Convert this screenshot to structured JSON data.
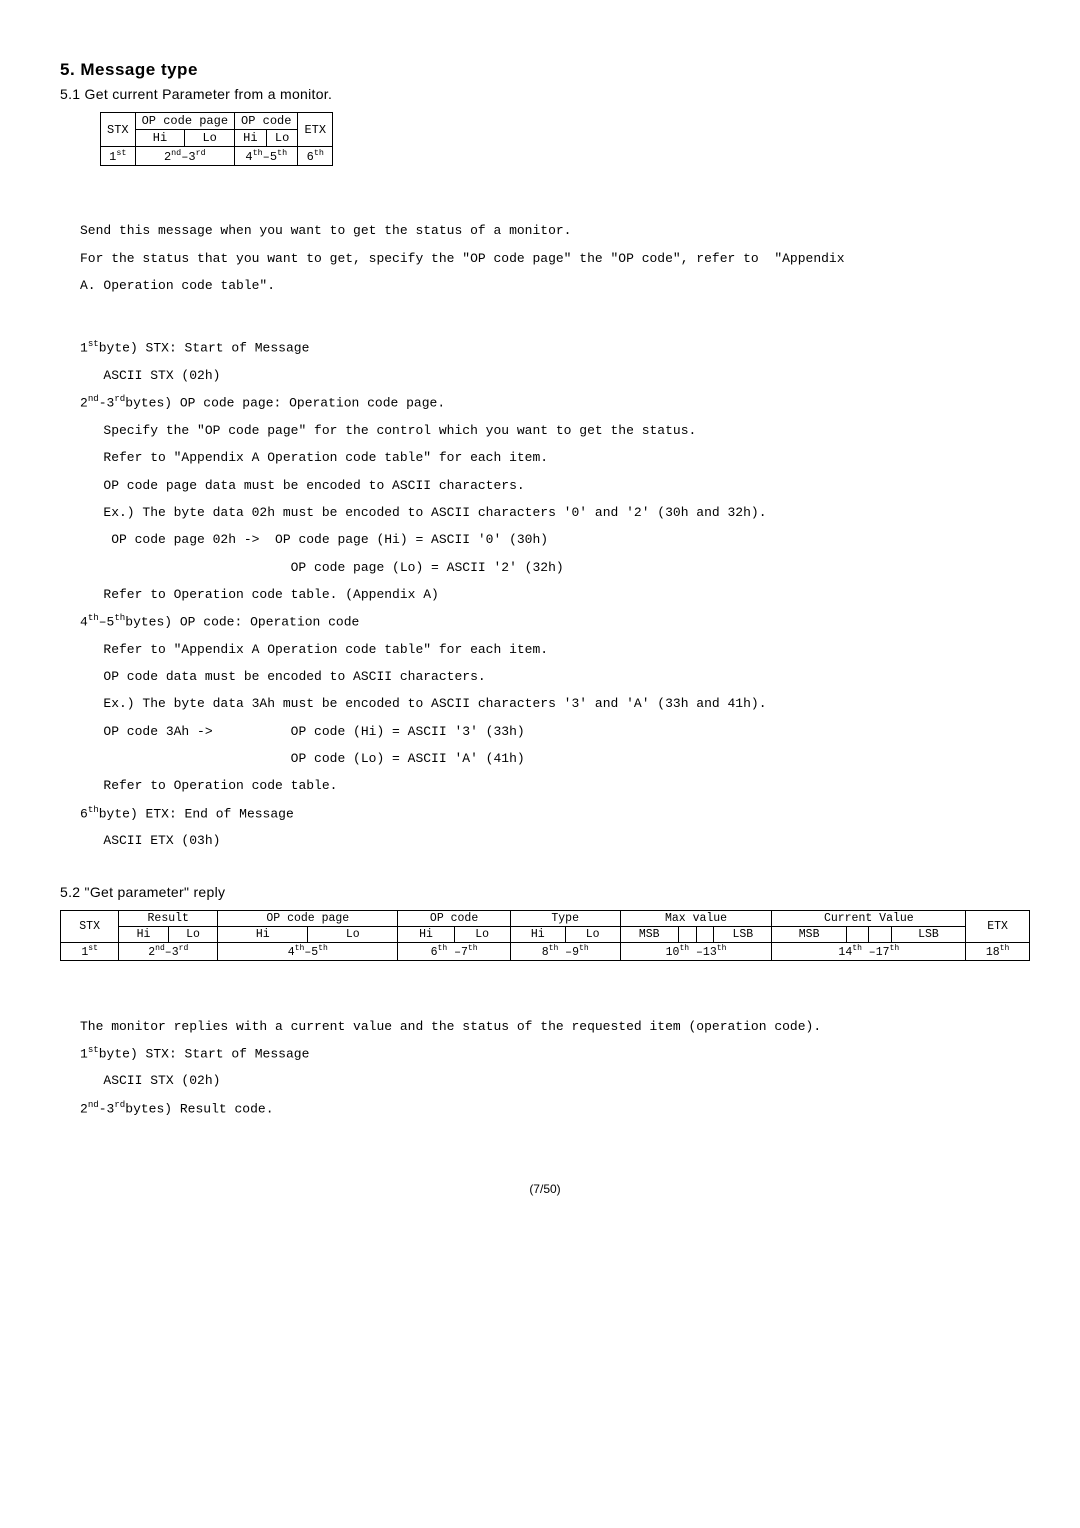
{
  "section_num": "5. Message type",
  "sub51": "5.1 Get current Parameter from a monitor.",
  "t1": {
    "h": [
      "STX",
      "OP code page",
      "OP code",
      "ETX"
    ],
    "sub": [
      "Hi",
      "Lo",
      "Hi",
      "Lo"
    ],
    "r": [
      "1",
      "st",
      "2",
      "nd",
      "–3",
      "rd",
      "4",
      "th",
      "–5",
      "th",
      "6",
      "th"
    ]
  },
  "t1_rows": {
    "r0c0": "STX",
    "r0c1": "OP code page",
    "r0c2": "OP code",
    "r0c3": "ETX",
    "r1c0": "Hi",
    "r1c1": "Lo",
    "r1c2": "Hi",
    "r1c3": "Lo",
    "r2c0_a": "1",
    "r2c0_b": "st",
    "r2c1_a": "2",
    "r2c1_b": "nd",
    "r2c1_c": "–3",
    "r2c1_d": "rd",
    "r2c2_a": "4",
    "r2c2_b": "th",
    "r2c2_c": "–5",
    "r2c2_d": "th",
    "r2c3_a": "6",
    "r2c3_b": "th"
  },
  "body1_l1": "Send this message when you want to get the status of a monitor.",
  "body1_l2": "For the status that you want to get, specify the \"OP code page\" the \"OP code\", refer to  \"Appendix",
  "body1_l3": "A. Operation code table\".",
  "b1_a": "1",
  "b1_b": "st",
  "b1_c": "byte) STX: Start of Message",
  "b1_d": "ASCII STX (02h)",
  "b2_a": "2",
  "b2_b": "nd",
  "b2_c": "-3",
  "b2_d": "rd",
  "b2_e": "bytes) OP code page: Operation code page.",
  "b2_l1": "Specify the \"OP code page\" for the control which you want to get the status.",
  "b2_l2": "Refer to \"Appendix A Operation code table\" for each item.",
  "b2_l3": "OP code page data must be encoded to ASCII characters.",
  "b2_l4": "Ex.) The byte data 02h must be encoded to ASCII characters '0' and '2' (30h and 32h).",
  "b2_l5": " OP code page 02h ->  OP code page (Hi) = ASCII '0' (30h)",
  "b2_l6": "                           OP code page (Lo) = ASCII '2' (32h)",
  "b2_l7": "Refer to Operation code table. (Appendix A)",
  "b3_a": "4",
  "b3_b": "th",
  "b3_c": "–5",
  "b3_d": "th",
  "b3_e": "bytes) OP code: Operation code",
  "b3_l1": "Refer to \"Appendix A Operation code table\" for each item.",
  "b3_l2": "OP code data must be encoded to ASCII characters.",
  "b3_l3": "Ex.) The byte data 3Ah must be encoded to ASCII characters '3' and 'A' (33h and 41h).",
  "b3_l4": "OP code 3Ah ->          OP code (Hi) = ASCII '3' (33h)",
  "b3_l5": "                        OP code (Lo) = ASCII 'A' (41h)",
  "b3_l6": "Refer to Operation code table.",
  "b4_a": "6",
  "b4_b": "th",
  "b4_c": "byte) ETX: End of Message",
  "b4_d": "ASCII ETX (03h)",
  "sub52": "5.2 \"Get parameter\" reply",
  "t2": {
    "h0": "STX",
    "h1": "Result",
    "h2": "OP code page",
    "h3": "OP code",
    "h4": "Type",
    "h5": "Max value",
    "h6": "Current Value",
    "h7": "ETX",
    "s1a": "Hi",
    "s1b": "Lo",
    "s2a": "Hi",
    "s2b": "Lo",
    "s3a": "Hi",
    "s3b": "Lo",
    "s4a": "Hi",
    "s4b": "Lo",
    "s5a": "MSB",
    "s5b": "",
    "s5c": "",
    "s5d": "LSB",
    "s6a": "MSB",
    "s6b": "",
    "s6c": "",
    "s6d": "LSB",
    "r0_a": "1",
    "r0_b": "st",
    "r1_a": "2",
    "r1_b": "nd",
    "r1_c": "–3",
    "r1_d": "rd",
    "r2_a": "4",
    "r2_b": "th",
    "r2_c": "–5",
    "r2_d": "th",
    "r3_a": "6",
    "r3_b": "th",
    "r3_c": " –7",
    "r3_d": "th",
    "r4_a": "8",
    "r4_b": "th",
    "r4_c": " –9",
    "r4_d": "th",
    "r5_a": "10",
    "r5_b": "th",
    "r5_c": " –13",
    "r5_d": "th",
    "r6_a": "14",
    "r6_b": "th",
    "r6_c": " –17",
    "r6_d": "th",
    "r7_a": "18",
    "r7_b": "th"
  },
  "body2_l1": "The monitor replies with a current value and the status of the requested item (operation code).",
  "c1_a": "1",
  "c1_b": "st",
  "c1_c": "byte) STX: Start of Message",
  "c1_d": "ASCII STX (02h)",
  "c2_a": "2",
  "c2_b": "nd",
  "c2_c": "-3",
  "c2_d": "rd",
  "c2_e": "bytes) Result code.",
  "footer": "(7/50)"
}
